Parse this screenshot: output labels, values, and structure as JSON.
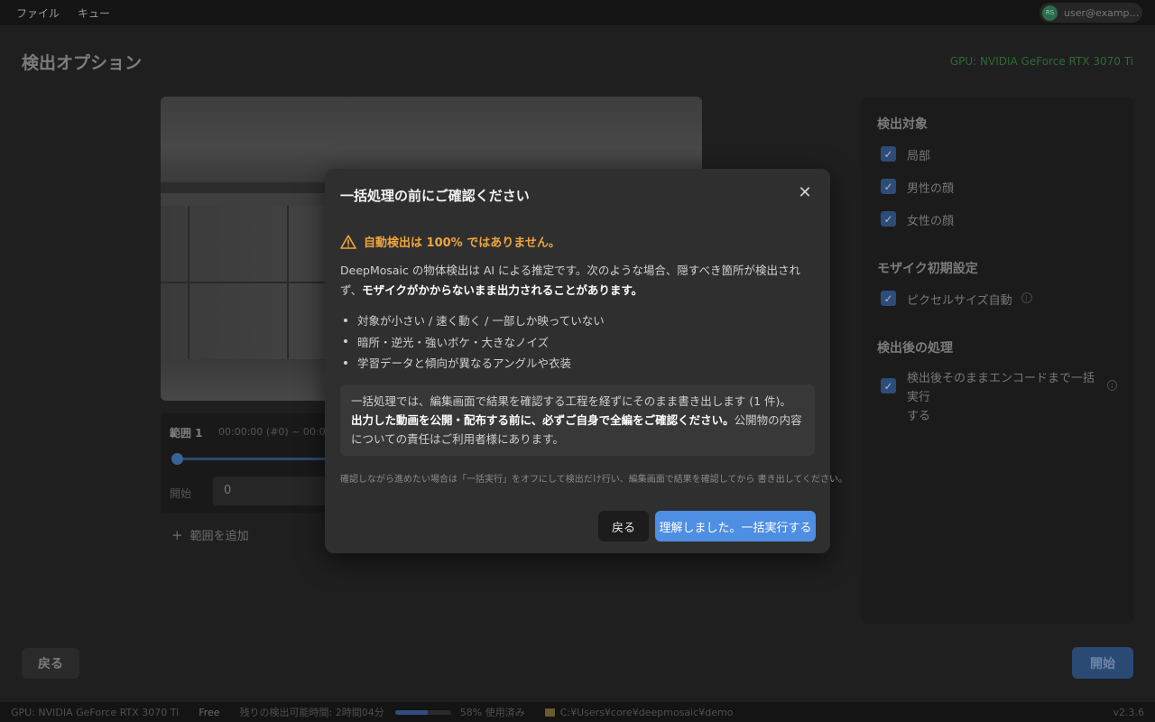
{
  "menubar": {
    "items": [
      "ファイル",
      "キュー"
    ]
  },
  "user": {
    "avatar_initials": "RS",
    "email": "user@example..."
  },
  "page": {
    "title": "検出オプション",
    "gpu": "GPU: NVIDIA GeForce RTX 3070 Ti"
  },
  "range": {
    "title": "範囲 1",
    "time": "00:00:00 (#0) ~ 00:00",
    "start_label": "開始",
    "start_value": "0",
    "add_label": "範囲を追加"
  },
  "settings": {
    "detect_heading": "検出対象",
    "targets": [
      "局部",
      "男性の顔",
      "女性の顔"
    ],
    "mosaic_heading": "モザイク初期設定",
    "pixel_auto": "ピクセルサイズ自動",
    "post_heading": "検出後の処理",
    "encode_line1": "検出後そのままエンコードまで一括実行",
    "encode_line2": "する"
  },
  "buttons": {
    "back": "戻る",
    "start": "開始"
  },
  "status": {
    "gpu": "GPU: NVIDIA GeForce RTX 3070 Ti",
    "plan": "Free",
    "remaining": "残りの検出可能時間: 2時間04分",
    "usage_percent": 58,
    "usage_label": "58% 使用済み",
    "path": "C:¥Users¥core¥deepmosaic¥demo",
    "version": "v2.3.6"
  },
  "dialog": {
    "title": "一括処理の前にご確認ください",
    "warning": "自動検出は 100% ではありません。",
    "body_plain": "DeepMosaic の物体検出は AI による推定です。次のような場合、隠すべき箇所が検出されず、",
    "body_bold": "モザイクがかからないまま出力されることがあります。",
    "bullets": [
      "対象が小さい / 速く動く / 一部しか映っていない",
      "暗所・逆光・強いボケ・大きなノイズ",
      "学習データと傾向が異なるアングルや衣装"
    ],
    "note_line1": "一括処理では、編集画面で結果を確認する工程を経ずにそのまま書き出します (1 件)。",
    "note_bold": "出力した動画を公開・配布する前に、必ずご自身で全編をご確認ください。",
    "note_rest": "公開物の内容についての責任はご利用者様にあります。",
    "hint": "確認しながら進めたい場合は「一括実行」をオフにして検出だけ行い、編集画面で結果を確認してから 書き出してください。",
    "back_label": "戻る",
    "confirm_label": "理解しました。一括実行する"
  },
  "colors": {
    "accent": "#4e8ee3",
    "warning": "#f0a53c"
  }
}
